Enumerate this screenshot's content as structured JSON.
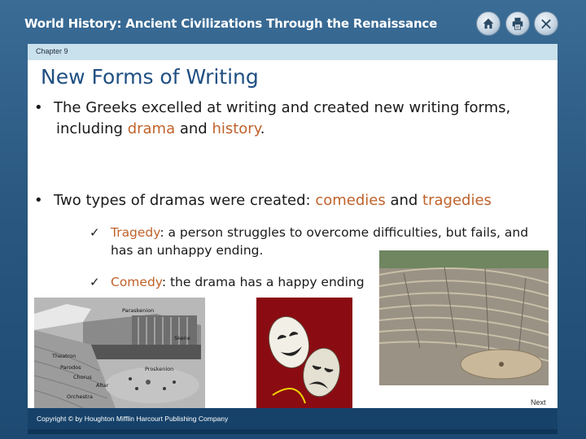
{
  "header": {
    "course_title": "World History: Ancient Civilizations Through the Renaissance",
    "buttons": {
      "home_icon": "home-icon",
      "print_icon": "printer-icon",
      "exit_icon": "close-icon"
    }
  },
  "chapter": {
    "label": "Chapter 9"
  },
  "slide": {
    "title": "New Forms of Writing",
    "bullet1": {
      "text_a": "The Greeks excelled at writing and created new writing forms,",
      "text_b": "including ",
      "hl1": "drama",
      "text_c": " and ",
      "hl2": "history",
      "text_d": "."
    },
    "bullet2": {
      "text_a": "Two types of dramas were created: ",
      "hl1": "comedies",
      "text_b": " and ",
      "hl2": "tragedies"
    },
    "sub1": {
      "hl": "Tragedy",
      "text_a": ": a person struggles to overcome difficulties, but fails, and",
      "text_b": "has an unhappy ending."
    },
    "sub2": {
      "hl": "Comedy",
      "text_a": ": the drama has a happy ending"
    },
    "theater_labels": {
      "skene": "Skene",
      "paraskenion": "Paraskenion",
      "theatron": "Theatron",
      "parodos": "Parodos",
      "proskenion": "Proskenion",
      "chorus": "Chorus",
      "altar": "Altar",
      "orchestra": "Orchestra"
    }
  },
  "footer": {
    "next_label": "Next",
    "copyright": "Copyright © by Houghton Mifflin Harcourt Publishing Company"
  },
  "colors": {
    "highlight": "#c0622b",
    "title": "#1f4f82",
    "frame": "#2a5880"
  }
}
